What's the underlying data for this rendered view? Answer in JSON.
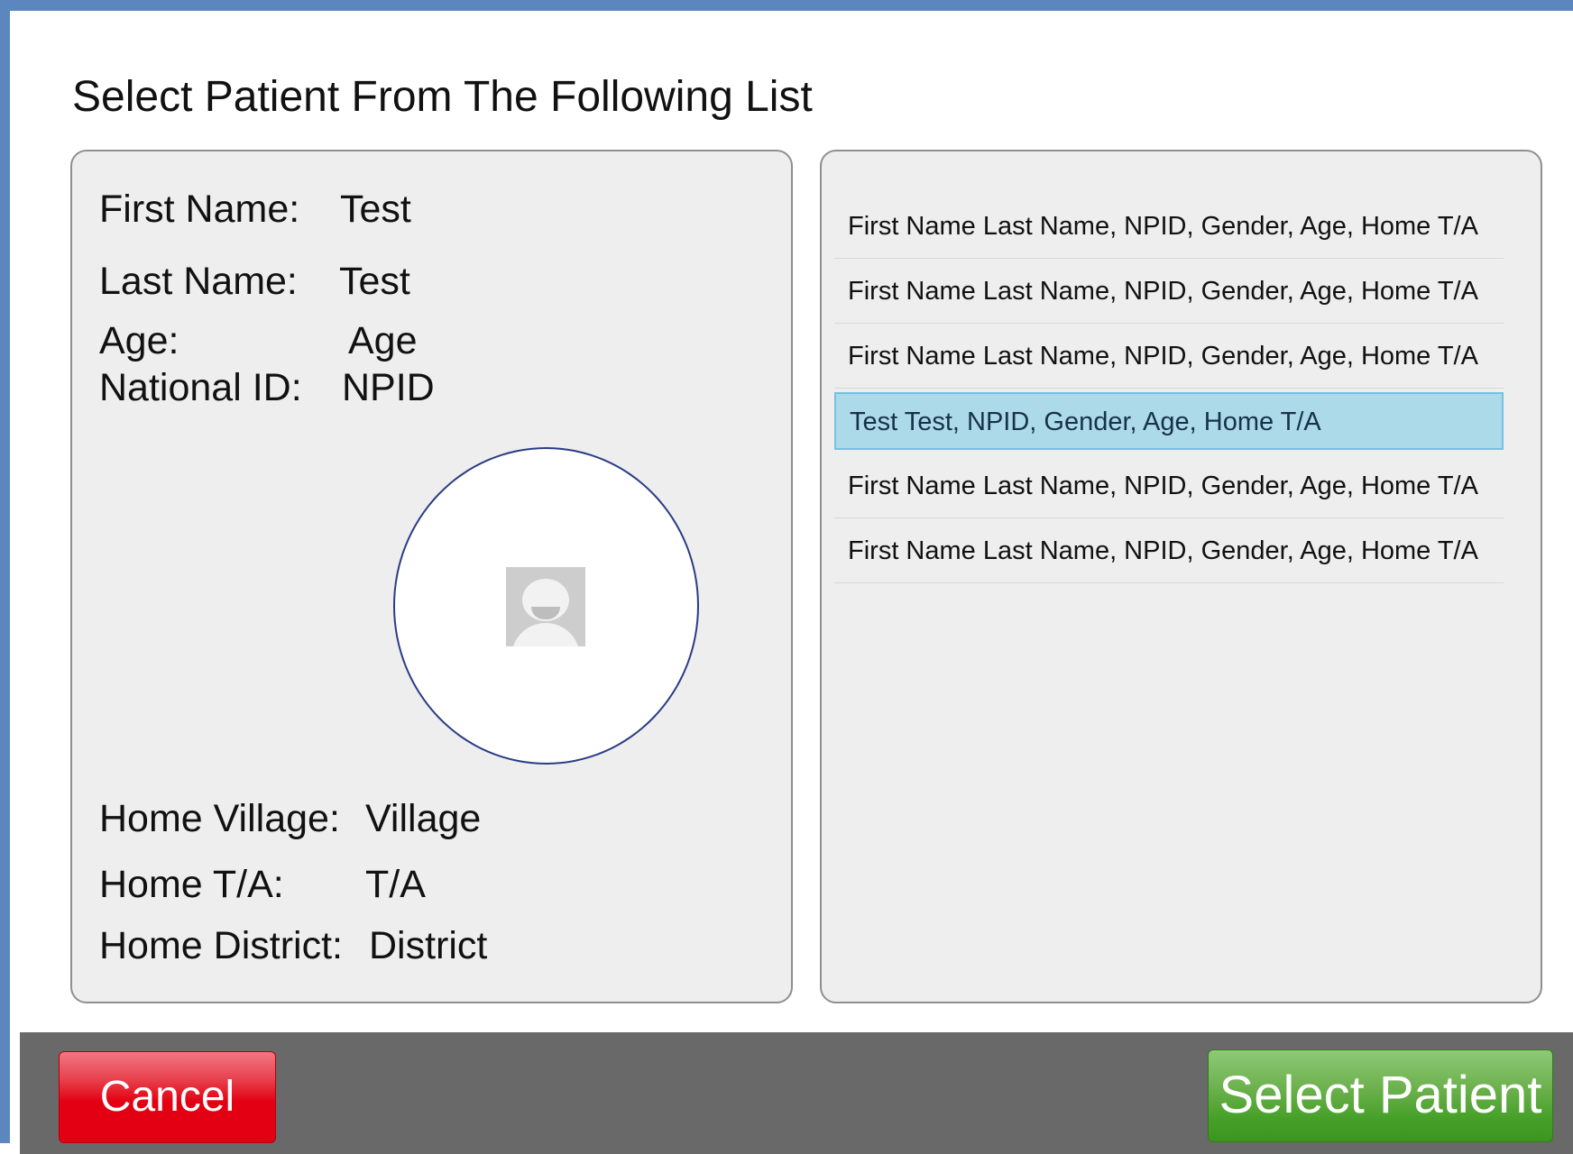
{
  "page": {
    "title": "Select Patient From The Following List"
  },
  "details": {
    "first_name": {
      "label": "First Name:",
      "value": "Test"
    },
    "last_name": {
      "label": "Last Name:",
      "value": "Test"
    },
    "age": {
      "label": "Age:",
      "value": "Age"
    },
    "national_id": {
      "label": "National ID:",
      "value": "NPID"
    },
    "home_village": {
      "label": "Home Village:",
      "value": "Village"
    },
    "home_ta": {
      "label": "Home T/A:",
      "value": "T/A"
    },
    "home_district": {
      "label": "Home District:",
      "value": "District"
    },
    "photo_icon": "user-silhouette-icon"
  },
  "patients": {
    "items": [
      {
        "label": "First Name Last Name, NPID, Gender, Age, Home T/A",
        "selected": false
      },
      {
        "label": "First Name Last Name, NPID, Gender, Age, Home T/A",
        "selected": false
      },
      {
        "label": "First Name Last Name, NPID, Gender, Age, Home T/A",
        "selected": false
      },
      {
        "label": "Test Test, NPID, Gender, Age, Home T/A",
        "selected": true
      },
      {
        "label": "First Name Last Name, NPID, Gender, Age, Home T/A",
        "selected": false
      },
      {
        "label": "First Name Last Name, NPID, Gender, Age, Home T/A",
        "selected": false
      }
    ]
  },
  "footer": {
    "cancel_label": "Cancel",
    "select_label": "Select Patient"
  },
  "colors": {
    "frame_border": "#5b86be",
    "panel_bg": "#eeeeee",
    "selected_row": "#acdae9",
    "footer_bg": "#696969",
    "cancel_button": "#e30012",
    "select_button": "#46a028",
    "photo_ring": "#2a3c85"
  }
}
